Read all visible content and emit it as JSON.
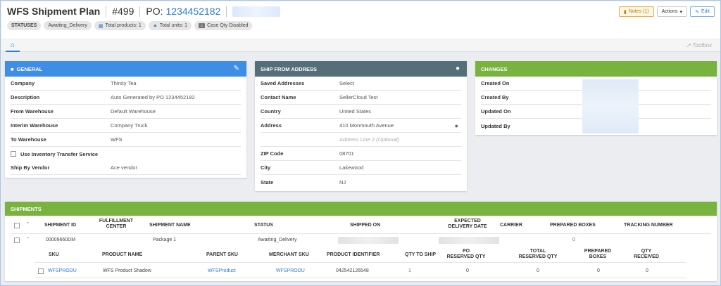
{
  "header": {
    "title": "WFS Shipment Plan",
    "number": "#499",
    "po_label": "PO:",
    "po_value": "1234452182",
    "notes_label": "Notes (1)",
    "actions_label": "Actions",
    "edit_label": "Edit"
  },
  "statuses": {
    "label": "STATUSES",
    "status": "Awaiting_Delivery",
    "total_products": "Total products: 1",
    "total_units": "Total units: 1",
    "case_qty": "Case Qty Disabled"
  },
  "tabs": {
    "toolbox": "Toolbox"
  },
  "general": {
    "title": "GENERAL",
    "rows": [
      {
        "k": "Company",
        "v": "Thirsty Tea"
      },
      {
        "k": "Description",
        "v": "Auto Generated by PO 1234452182"
      },
      {
        "k": "From Warehouse",
        "v": "Default Warehouse"
      },
      {
        "k": "Interim Warehouse",
        "v": "Company Truck"
      },
      {
        "k": "To Warehouse",
        "v": "WFS"
      },
      {
        "k": "Use Inventory Transfer Service",
        "v": ""
      },
      {
        "k": "Ship By Vendor",
        "v": "Ace vendor"
      }
    ]
  },
  "ship_from": {
    "title": "SHIP FROM ADDRESS",
    "rows": [
      {
        "k": "Saved Addresses",
        "v": "Select"
      },
      {
        "k": "Contact Name",
        "v": "SellerCloud Test"
      },
      {
        "k": "Country",
        "v": "United States"
      },
      {
        "k": "Address",
        "v": "410 Monmouth Avenue"
      },
      {
        "k": "",
        "v": "Address Line 2 (Optional)"
      },
      {
        "k": "ZIP Code",
        "v": "08701"
      },
      {
        "k": "City",
        "v": "Lakewood"
      },
      {
        "k": "State",
        "v": "NJ"
      }
    ]
  },
  "changes": {
    "title": "CHANGES",
    "rows": [
      {
        "k": "Created On"
      },
      {
        "k": "Created By"
      },
      {
        "k": "Updated On"
      },
      {
        "k": "Updated By"
      }
    ]
  },
  "shipments": {
    "title": "SHIPMENTS",
    "headers": {
      "shipment_id": "SHIPMENT ID",
      "fulfillment_center": "FULFILLMENT\nCENTER",
      "shipment_name": "SHIPMENT NAME",
      "status": "STATUS",
      "shipped_on": "SHIPPED ON",
      "expected_delivery": "EXPECTED\nDELIVERY DATE",
      "carrier": "CARRIER",
      "prepared_boxes": "PREPARED BOXES",
      "tracking": "TRACKING NUMBER"
    },
    "row": {
      "shipment_id": "00009660DM",
      "shipment_name": "Package 1",
      "status": "Awaiting_Delivery",
      "prepared_boxes": "0"
    },
    "sub_headers": {
      "sku": "SKU",
      "product_name": "PRODUCT NAME",
      "parent_sku": "PARENT SKU",
      "merchant_sku": "MERCHANT SKU",
      "product_identifier": "PRODUCT IDENTIFIER",
      "qty_to_ship": "QTY TO SHIP",
      "po_reserved": "PO\nRESERVED QTY",
      "total_reserved": "TOTAL\nRESERVED QTY",
      "prepared_boxes": "PREPARED\nBOXES",
      "qty_received": "QTY\nRECEIVED"
    },
    "sub_row": {
      "sku": "WFSPRODU",
      "product_name": "WFS Product Shadow",
      "parent_sku": "WFSProduct",
      "merchant_sku": "WFSPRODU",
      "product_identifier": "042542126548",
      "qty_to_ship": "1",
      "po_reserved": "0",
      "total_reserved": "0",
      "prepared_boxes": "0",
      "qty_received": "0"
    }
  },
  "colors": {
    "general_header": "#3f8ee6",
    "ship_from_header": "#546e7a",
    "changes_header": "#79b33f",
    "link": "#2a7fd4"
  }
}
